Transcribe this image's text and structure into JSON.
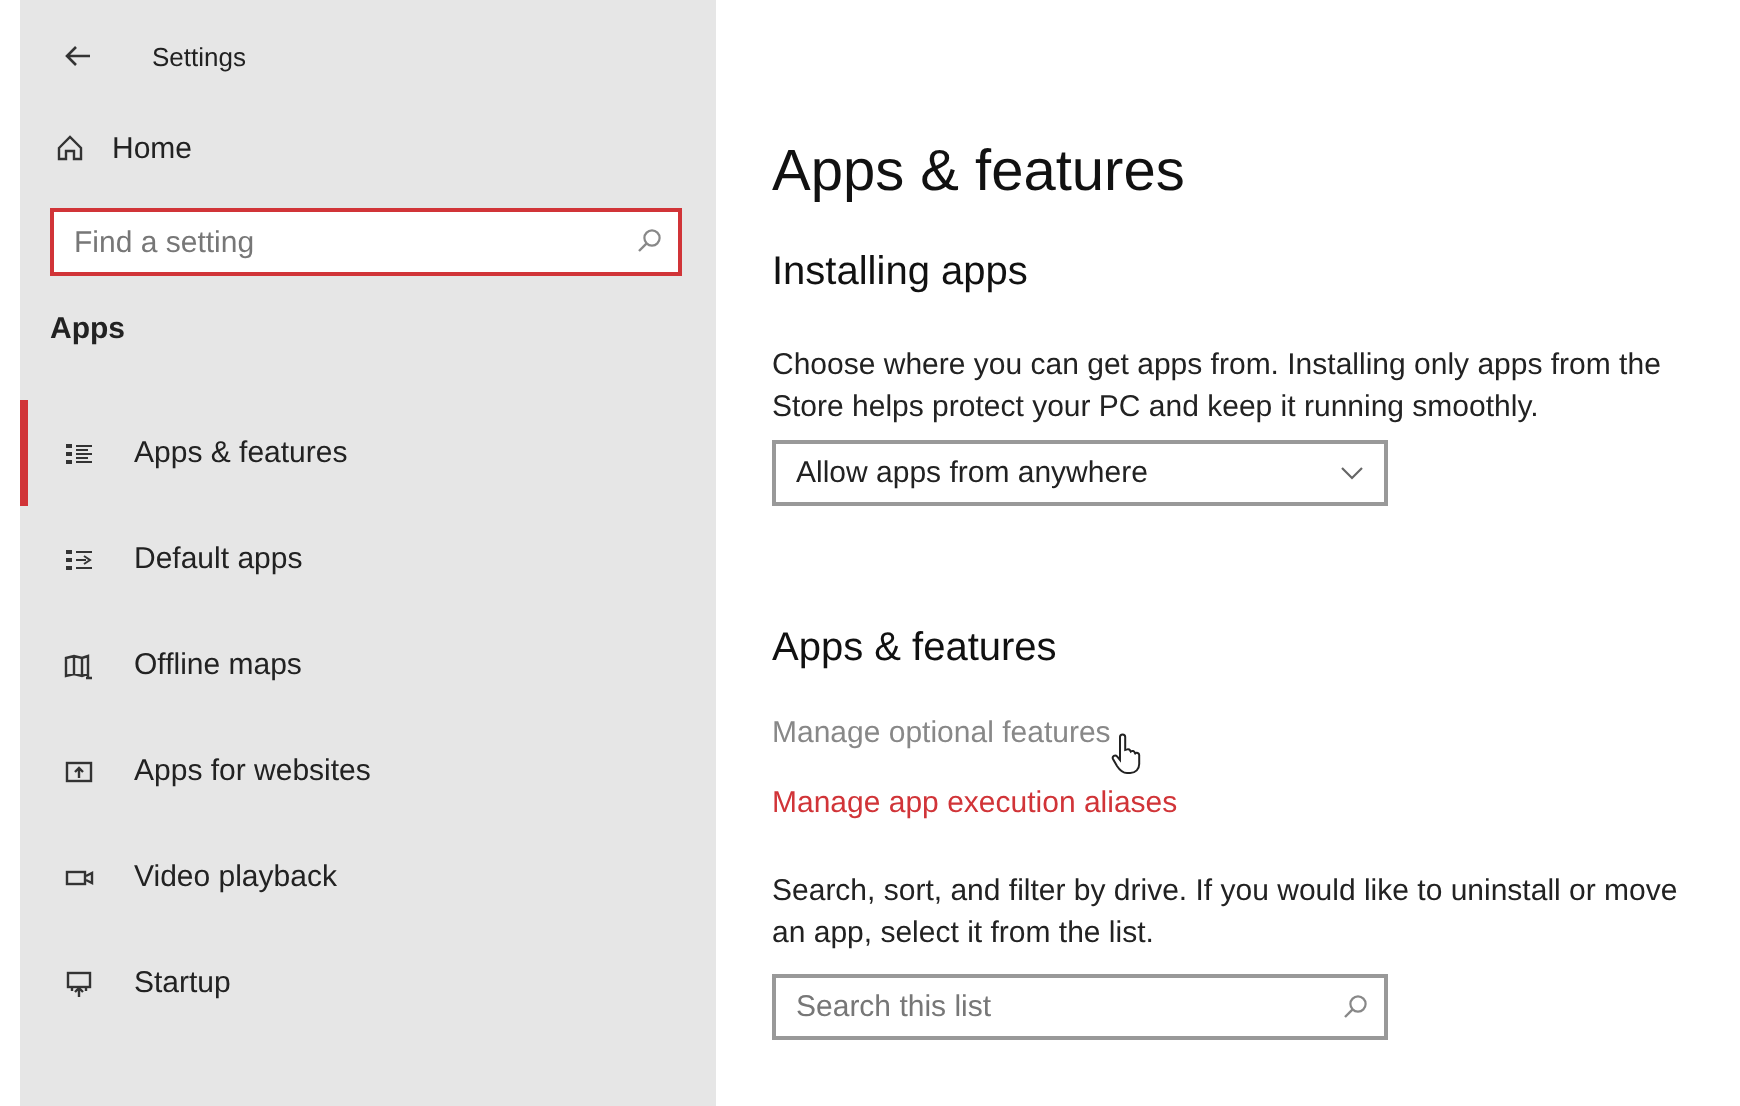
{
  "window": {
    "title": "Settings"
  },
  "sidebar": {
    "home": "Home",
    "search": {
      "placeholder": "Find a setting"
    },
    "section": "Apps",
    "items": [
      {
        "label": "Apps & features",
        "selected": true
      },
      {
        "label": "Default apps",
        "selected": false
      },
      {
        "label": "Offline maps",
        "selected": false
      },
      {
        "label": "Apps for websites",
        "selected": false
      },
      {
        "label": "Video playback",
        "selected": false
      },
      {
        "label": "Startup",
        "selected": false
      }
    ]
  },
  "main": {
    "title": "Apps & features",
    "installing": {
      "heading": "Installing apps",
      "description": "Choose where you can get apps from. Installing only apps from the Store helps protect your PC and keep it running smoothly.",
      "dropdown": "Allow apps from anywhere"
    },
    "features": {
      "heading": "Apps & features",
      "links": [
        {
          "label": "Manage optional features",
          "hovered": true
        },
        {
          "label": "Manage app execution aliases",
          "hovered": false
        }
      ],
      "description": "Search, sort, and filter by drive. If you would like to uninstall or move an app, select it from the list.",
      "search": {
        "placeholder": "Search this list"
      }
    }
  }
}
